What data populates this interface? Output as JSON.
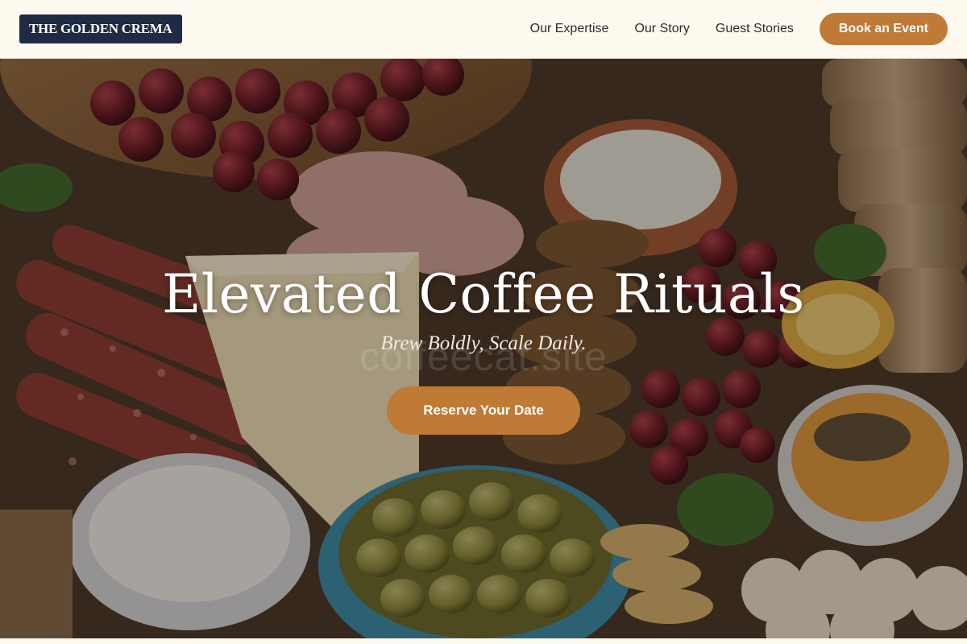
{
  "header": {
    "logo_text": "THE GOLDEN CREMA",
    "nav": [
      {
        "label": "Our Expertise"
      },
      {
        "label": "Our Story"
      },
      {
        "label": "Guest Stories"
      }
    ],
    "cta_label": "Book an Event"
  },
  "hero": {
    "title": "Elevated Coffee Rituals",
    "subtitle": "Brew Boldly, Scale Daily.",
    "watermark": "coffeecat.site",
    "cta_label": "Reserve Your Date",
    "background": "grazing-board-photo"
  },
  "colors": {
    "accent": "#bf7a36",
    "logo_bg": "#1f2b45",
    "header_bg": "#fdf9ef"
  }
}
